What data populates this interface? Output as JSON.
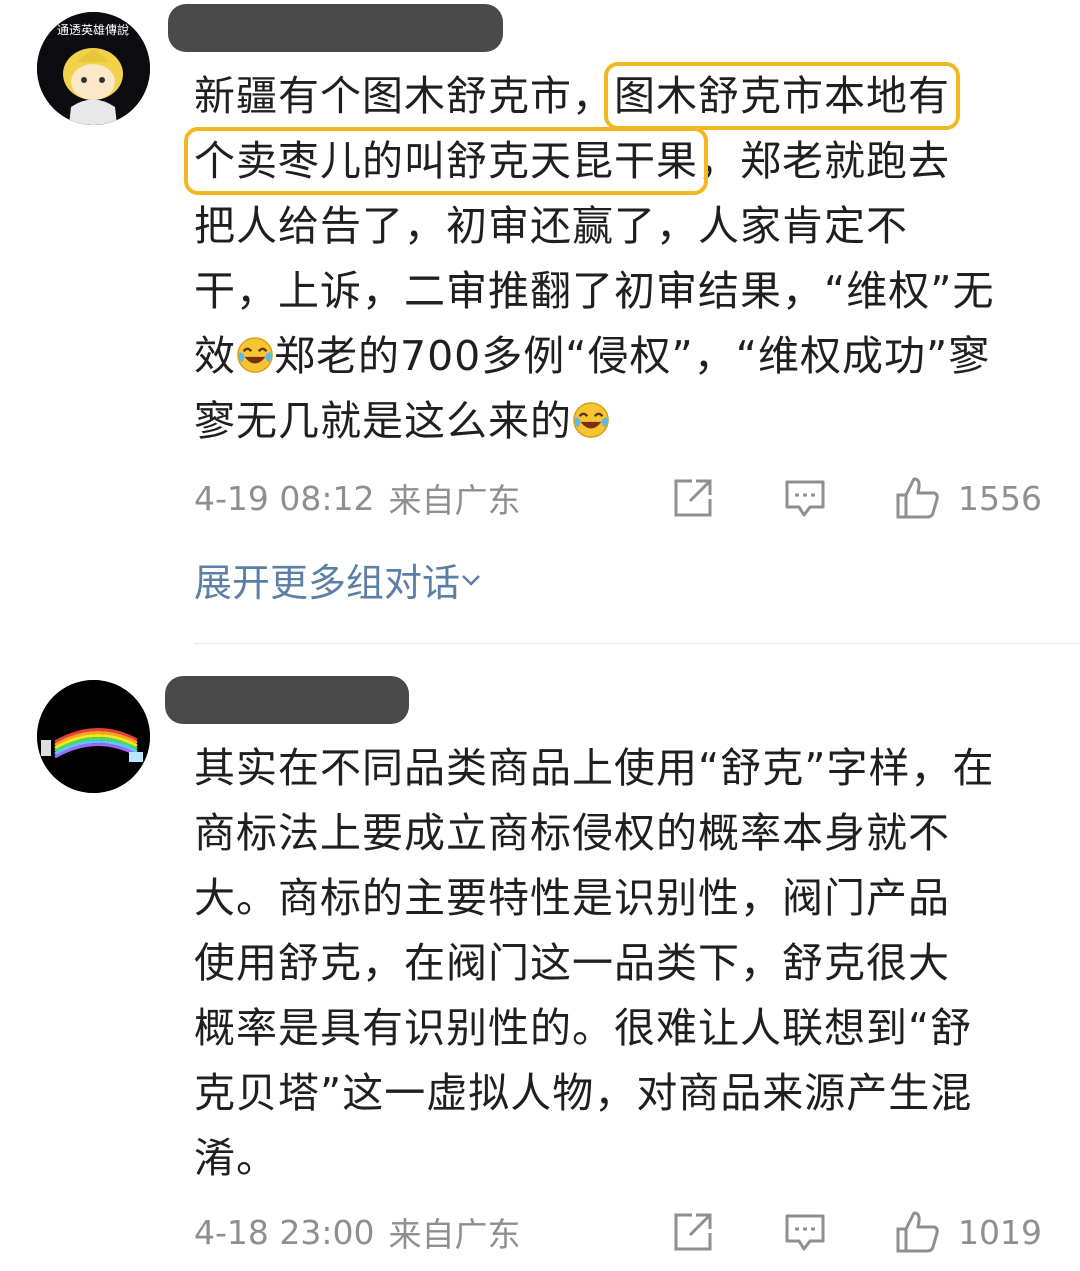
{
  "comments": [
    {
      "avatar": "anime-character-avatar",
      "avatar_text": "通透英雄傳說",
      "lines": [
        [
          "新疆有个图木舒克市，",
          "图木舒克市本地有"
        ],
        [
          "个卖枣儿的叫舒克天昆干果",
          "，郑老就跑去"
        ],
        [
          "把人给告了，初审还赢了，人家肯定不"
        ],
        [
          "干，上诉，二审推翻了初审结果，“维权”无"
        ],
        [
          "效",
          "郑老的700多例“侵权”，“维权成功”寥"
        ],
        [
          "寥无几就是这么来的"
        ]
      ],
      "time": "4-19 08:12",
      "location": "来自广东",
      "likes": "1556",
      "expand_label": "展开更多组对话"
    },
    {
      "avatar": "rainbow-night-avatar",
      "lines": [
        [
          "其实在不同品类商品上使用“舒克”字样，在"
        ],
        [
          "商标法上要成立商标侵权的概率本身就不"
        ],
        [
          "大。商标的主要特性是识别性，阀门产品"
        ],
        [
          "使用舒克，在阀门这一品类下，舒克很大"
        ],
        [
          "概率是具有识别性的。很难让人联想到“舒"
        ],
        [
          "克贝塔”这一虚拟人物，对商品来源产生混"
        ],
        [
          "淆。"
        ]
      ],
      "time": "4-18 23:00",
      "location": "来自广东",
      "likes": "1019"
    }
  ],
  "colors": {
    "highlight": "#f3b81f",
    "link": "#5b7fa6",
    "meta": "#8f8f8f"
  },
  "icons": [
    "share-icon",
    "comment-icon",
    "like-icon",
    "laugh-cry-emoji",
    "chevron-down-icon"
  ]
}
